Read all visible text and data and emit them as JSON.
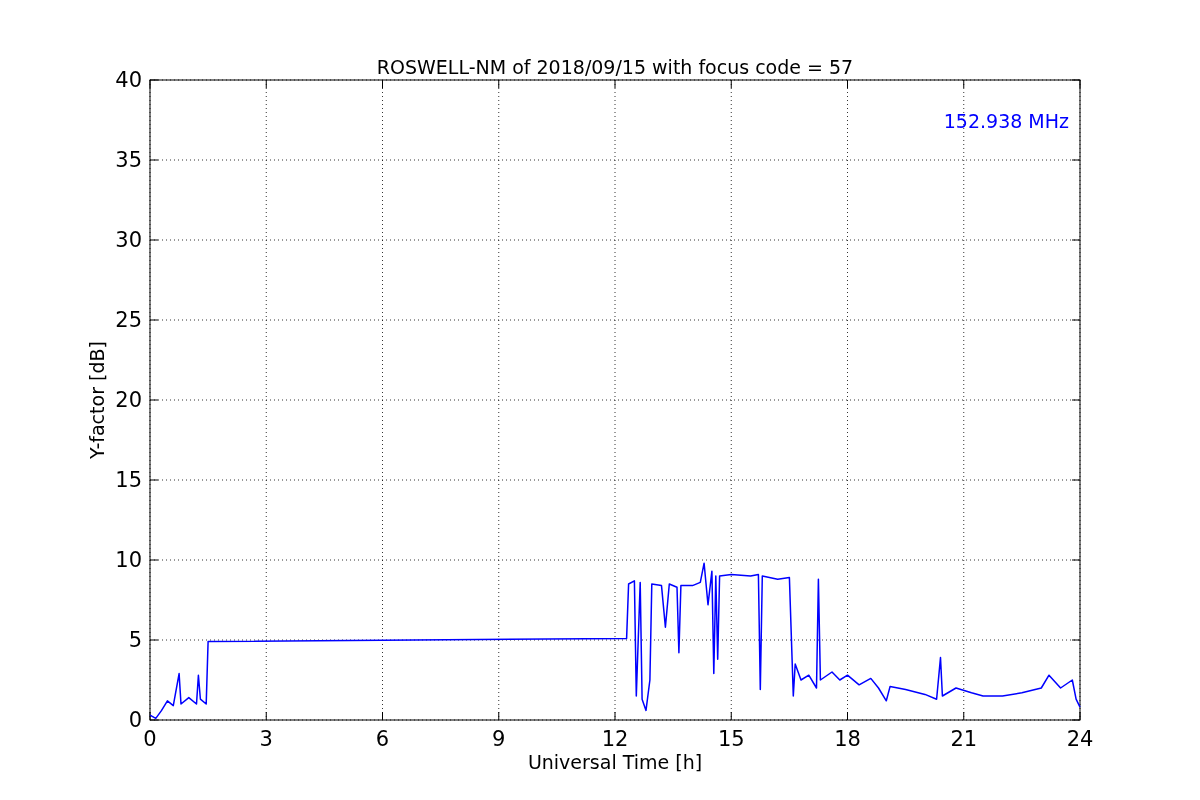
{
  "chart": {
    "chart_data": {
      "type": "line",
      "title": "ROSWELL-NM of 2018/09/15 with focus code = 57",
      "xlabel": "Universal Time [h]",
      "ylabel": "Y-factor [dB]",
      "xlim": [
        0,
        24
      ],
      "ylim": [
        0,
        40
      ],
      "xticks": [
        0,
        3,
        6,
        9,
        12,
        15,
        18,
        21,
        24
      ],
      "yticks": [
        0,
        5,
        10,
        15,
        20,
        25,
        30,
        35,
        40
      ],
      "x": [
        0,
        0.15,
        0.3,
        0.45,
        0.6,
        0.75,
        0.8,
        1.0,
        1.2,
        1.25,
        1.3,
        1.45,
        1.5,
        12.3,
        12.35,
        12.5,
        12.55,
        12.65,
        12.7,
        12.8,
        12.9,
        12.95,
        13.2,
        13.3,
        13.4,
        13.6,
        13.65,
        13.7,
        14.0,
        14.2,
        14.3,
        14.4,
        14.5,
        14.55,
        14.6,
        14.65,
        14.7,
        15.0,
        15.5,
        15.7,
        15.75,
        15.8,
        16.2,
        16.5,
        16.6,
        16.65,
        16.8,
        17.0,
        17.2,
        17.25,
        17.3,
        17.6,
        17.8,
        18.0,
        18.3,
        18.6,
        18.8,
        19.0,
        19.1,
        19.5,
        20.0,
        20.3,
        20.4,
        20.45,
        20.8,
        21.2,
        21.5,
        22.0,
        22.5,
        23.0,
        23.2,
        23.5,
        23.8,
        23.9,
        24.0
      ],
      "series": [
        {
          "name": "152.938 MHz",
          "color": "#0000ff",
          "values": [
            0.3,
            0.1,
            0.6,
            1.2,
            0.9,
            2.9,
            1.0,
            1.4,
            1.0,
            2.8,
            1.3,
            1.0,
            4.9,
            5.1,
            8.5,
            8.7,
            1.5,
            8.6,
            1.3,
            0.6,
            2.5,
            8.5,
            8.4,
            5.8,
            8.5,
            8.3,
            4.2,
            8.4,
            8.4,
            8.6,
            9.8,
            7.2,
            9.3,
            2.9,
            9.0,
            3.8,
            9.0,
            9.1,
            9.0,
            9.1,
            1.9,
            9.0,
            8.8,
            8.9,
            1.5,
            3.5,
            2.5,
            2.8,
            2.0,
            8.8,
            2.5,
            3.0,
            2.5,
            2.8,
            2.2,
            2.6,
            2.0,
            1.2,
            2.1,
            1.9,
            1.6,
            1.3,
            3.9,
            1.5,
            2.0,
            1.7,
            1.5,
            1.5,
            1.7,
            2.0,
            2.8,
            2.0,
            2.5,
            1.3,
            0.8
          ]
        }
      ],
      "grid": true
    }
  }
}
